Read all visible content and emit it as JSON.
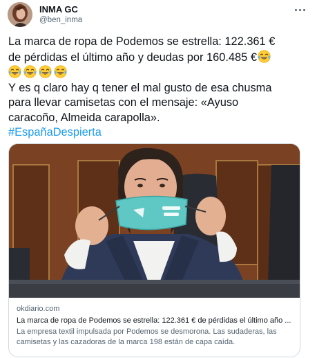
{
  "author": {
    "name": "INMA GC",
    "handle": "@ben_inma"
  },
  "tweet": {
    "line1": "La marca de ropa de Podemos se estrella: 122.361 €",
    "line2a": "de pérdidas el último año y deudas por 160.485 €",
    "line4": "Y es q claro hay q tener el mal gusto de esa chusma",
    "line5": "para llevar camisetas con el mensaje: «Ayuso",
    "line6": "caracoño, Almeida carapolla».",
    "hashtag": "#EspañaDespierta",
    "emoji": "face-with-tears-of-joy-icon"
  },
  "card": {
    "domain": "okdiario.com",
    "title": "La marca de ropa de Podemos se estrella: 122.361 € de pérdidas el último año ...",
    "description": "La empresa textil impulsada por Podemos se desmorona. Las sudaderas, las camisetas y las cazadoras de la marca 198 están de capa caída."
  },
  "colors": {
    "link": "#1d9bf0",
    "text": "#0f1419",
    "secondary": "#536471",
    "border": "#cfd9de"
  }
}
